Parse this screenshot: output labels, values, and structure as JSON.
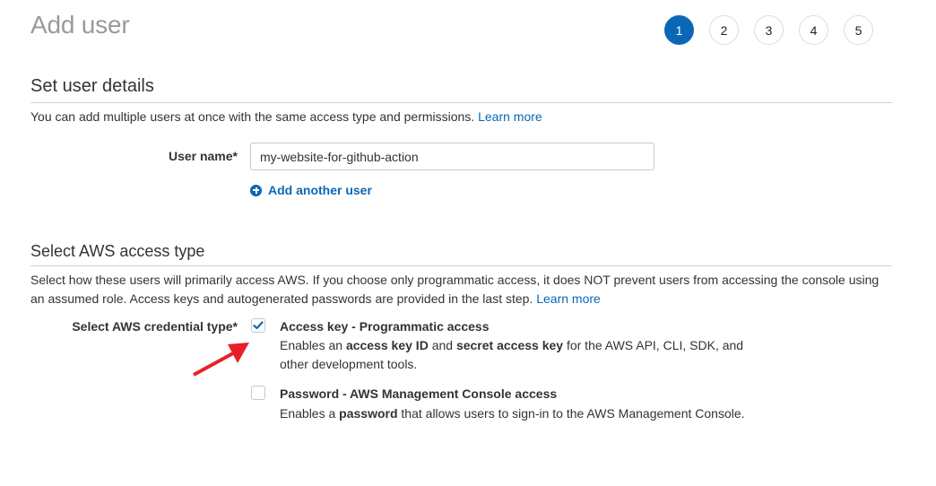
{
  "page": {
    "title": "Add user"
  },
  "stepper": {
    "steps": [
      "1",
      "2",
      "3",
      "4",
      "5"
    ],
    "active_step": "1",
    "accent_color": "#0a67b5"
  },
  "user_details": {
    "heading": "Set user details",
    "description": "You can add multiple users at once with the same access type and permissions.",
    "learn_more": "Learn more",
    "username_label": "User name*",
    "username_value": "my-website-for-github-action",
    "add_another_user": "Add another user"
  },
  "access_type": {
    "heading": "Select AWS access type",
    "description": "Select how these users will primarily access AWS. If you choose only programmatic access, it does NOT prevent users from accessing the console using an assumed role. Access keys and autogenerated passwords are provided in the last step.",
    "learn_more": "Learn more",
    "credential_label": "Select AWS credential type*",
    "options": [
      {
        "title": "Access key - Programmatic access",
        "checked": true,
        "desc_parts": [
          "Enables an ",
          "access key ID",
          " and ",
          "secret access key",
          " for the AWS API, CLI, SDK, and other development tools."
        ]
      },
      {
        "title": "Password - AWS Management Console access",
        "checked": false,
        "desc_parts": [
          "Enables a ",
          "password",
          " that allows users to sign-in to the AWS Management Console."
        ]
      }
    ]
  },
  "annotation": {
    "arrow_color": "#e8202a",
    "points_to": "access-key-checkbox"
  }
}
